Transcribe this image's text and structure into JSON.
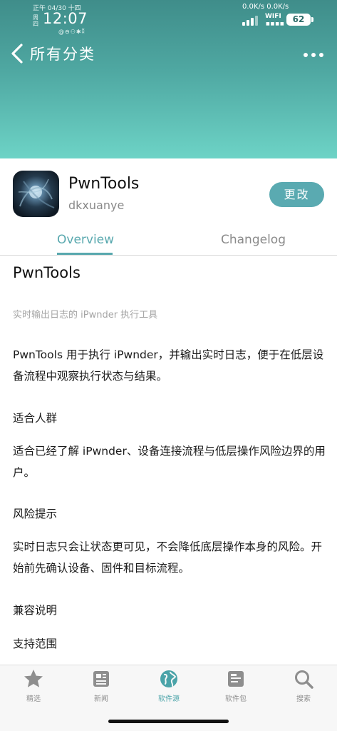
{
  "status_bar": {
    "date": "正午 04/30 十四",
    "weekday": "周四",
    "time": "12:07",
    "small_icons": "@⊖⚇✱⁑",
    "net_speed": "0.0K/s 0.0K/s",
    "wifi_label": "WIFI",
    "wifi_dots": "■■■■",
    "battery": "62"
  },
  "nav": {
    "title": "所有分类",
    "back_icon": "chevron-left-icon",
    "more_icon": "more-dots-icon"
  },
  "app": {
    "name": "PwnTools",
    "developer": "dkxuanye",
    "get_button": "更改"
  },
  "tabs": {
    "overview": "Overview",
    "changelog": "Changelog"
  },
  "content": {
    "title": "PwnTools",
    "subtitle": "实时输出日志的 iPwnder 执行工具",
    "paragraph1": "PwnTools 用于执行 iPwnder，并输出实时日志，便于在低层设备流程中观察执行状态与结果。",
    "section1_title": "适合人群",
    "paragraph2": "适合已经了解 iPwnder、设备连接流程与低层操作风险边界的用户。",
    "section2_title": "风险提示",
    "paragraph3": "实时日志只会让状态更可见，不会降低底层操作本身的风险。开始前先确认设备、固件和目标流程。",
    "section3_title": "兼容说明",
    "section4_title": "支持范围"
  },
  "tabbar": {
    "items": [
      {
        "label": "精选",
        "icon": "star-icon"
      },
      {
        "label": "新闻",
        "icon": "news-icon"
      },
      {
        "label": "软件源",
        "icon": "globe-icon"
      },
      {
        "label": "软件包",
        "icon": "package-icon"
      },
      {
        "label": "搜索",
        "icon": "search-icon"
      }
    ],
    "active_index": 2
  },
  "colors": {
    "accent": "#58a8ae",
    "header_top": "#3f8d8a",
    "header_bottom": "#6dd3c6"
  }
}
